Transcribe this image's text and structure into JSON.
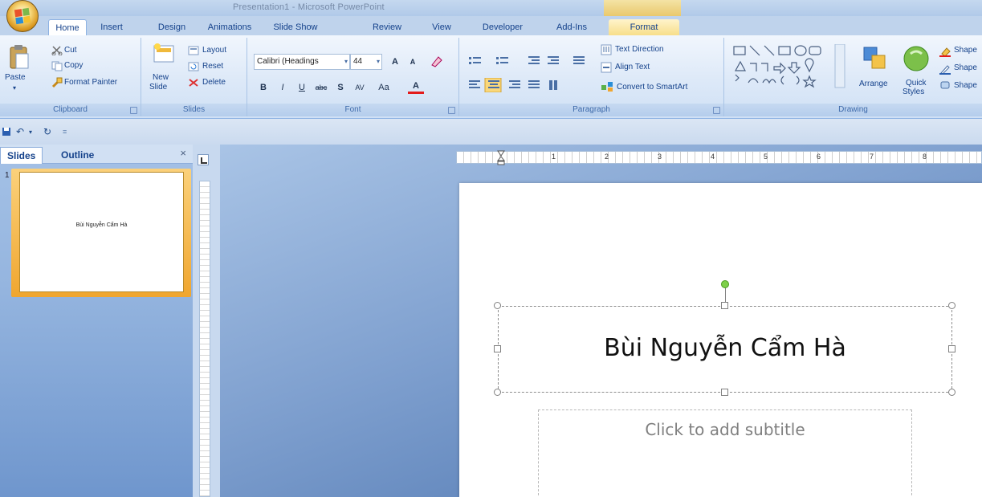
{
  "window": {
    "title": "Presentation1 - Microsoft PowerPoint"
  },
  "tabs": [
    {
      "label": "Home"
    },
    {
      "label": "Insert"
    },
    {
      "label": "Design"
    },
    {
      "label": "Animations"
    },
    {
      "label": "Slide Show"
    },
    {
      "label": "Review"
    },
    {
      "label": "View"
    },
    {
      "label": "Developer"
    },
    {
      "label": "Add-Ins"
    },
    {
      "label": "Format"
    }
  ],
  "ribbon": {
    "clipboard": {
      "label": "Clipboard",
      "paste": "Paste",
      "cut": "Cut",
      "copy": "Copy",
      "format_painter": "Format Painter"
    },
    "slides": {
      "label": "Slides",
      "new_slide_1": "New",
      "new_slide_2": "Slide",
      "layout": "Layout",
      "reset": "Reset",
      "delete": "Delete"
    },
    "font": {
      "label": "Font",
      "font_name": "Calibri (Headings",
      "font_size": "44",
      "grow": "A",
      "shrink": "A",
      "bold": "B",
      "italic": "I",
      "underline": "U",
      "strike": "abc",
      "shadow": "S",
      "spacing": "AV",
      "case": "Aa",
      "color": "A"
    },
    "paragraph": {
      "label": "Paragraph",
      "text_direction": "Text Direction",
      "align_text": "Align Text",
      "smartart": "Convert to SmartArt"
    },
    "drawing": {
      "label": "Drawing",
      "arrange": "Arrange",
      "quick_styles_1": "Quick",
      "quick_styles_2": "Styles",
      "shape_fill": "Shape",
      "shape_outline": "Shape",
      "shape_effects": "Shape"
    }
  },
  "left_panel": {
    "tab_slides": "Slides",
    "tab_outline": "Outline",
    "close": "×",
    "slide_number": "1",
    "thumb_title": "Bùi Nguyễn Cẩm Hà"
  },
  "ruler": {
    "marks": [
      "1",
      "1",
      "2",
      "3",
      "4",
      "5",
      "6",
      "7",
      "8"
    ]
  },
  "slide": {
    "title": "Bùi Nguyễn Cẩm Hà",
    "subtitle_placeholder": "Click to add subtitle"
  },
  "colors": {
    "accent": "#15428b",
    "ribbon_bg": "#dde9f8",
    "thumb_selection": "#f0a62f",
    "rotation_handle": "#7ed04a"
  }
}
